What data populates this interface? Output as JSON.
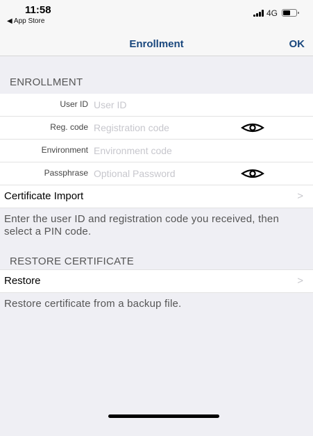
{
  "status_bar": {
    "time": "11:58",
    "back_app": "◀ App Store",
    "network": "4G",
    "battery_level": 0.55
  },
  "nav": {
    "title": "Enrollment",
    "ok_label": "OK"
  },
  "enrollment": {
    "header": "ENROLLMENT",
    "fields": [
      {
        "label": "User ID",
        "value": "",
        "placeholder": "User ID",
        "reveal_icon": false
      },
      {
        "label": "Reg. code",
        "value": "",
        "placeholder": "Registration code",
        "reveal_icon": true
      },
      {
        "label": "Environment",
        "value": "",
        "placeholder": "Environment code",
        "reveal_icon": false
      },
      {
        "label": "Passphrase",
        "value": "",
        "placeholder": "Optional Password",
        "reveal_icon": true
      }
    ],
    "import_label": "Certificate Import",
    "chevron": ">",
    "footer": "Enter the user ID and registration code you received, then select a PIN code."
  },
  "restore": {
    "header": "RESTORE CERTIFICATE",
    "restore_label": "Restore",
    "chevron": ">",
    "footer": "Restore certificate from a backup file."
  },
  "icons": {
    "eye": "eye-icon",
    "chevron": "chevron-right-icon",
    "signal": "signal-icon",
    "battery": "battery-icon"
  },
  "colors": {
    "accent": "#19477d",
    "background": "#efeff4",
    "placeholder": "#c7c7cd"
  }
}
